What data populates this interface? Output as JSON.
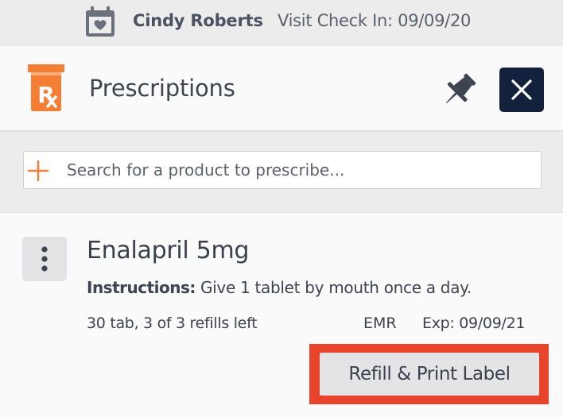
{
  "visit": {
    "patient_name": "Cindy Roberts",
    "checkin_text": "Visit Check In: 09/09/20",
    "icon": "calendar-heart-icon"
  },
  "panel": {
    "title": "Prescriptions",
    "icon": "rx-bottle-icon",
    "pin_icon": "pin-icon",
    "close_icon": "close-icon",
    "accent_color": "#f37e34",
    "close_bg": "#14213d"
  },
  "search": {
    "placeholder": "Search for a product to prescribe...",
    "value": "",
    "icon": "plus-icon"
  },
  "prescription": {
    "drug_name": "Enalapril 5mg",
    "instructions_label": "Instructions:",
    "instructions_text": " Give 1 tablet by mouth once a day.",
    "refills_text": "30 tab, 3 of 3 refills left",
    "source": "EMR",
    "expiry": "Exp: 09/09/21",
    "menu_icon": "kebab-menu-icon",
    "action_label": "Refill & Print Label",
    "highlight_color": "#e8432b"
  }
}
